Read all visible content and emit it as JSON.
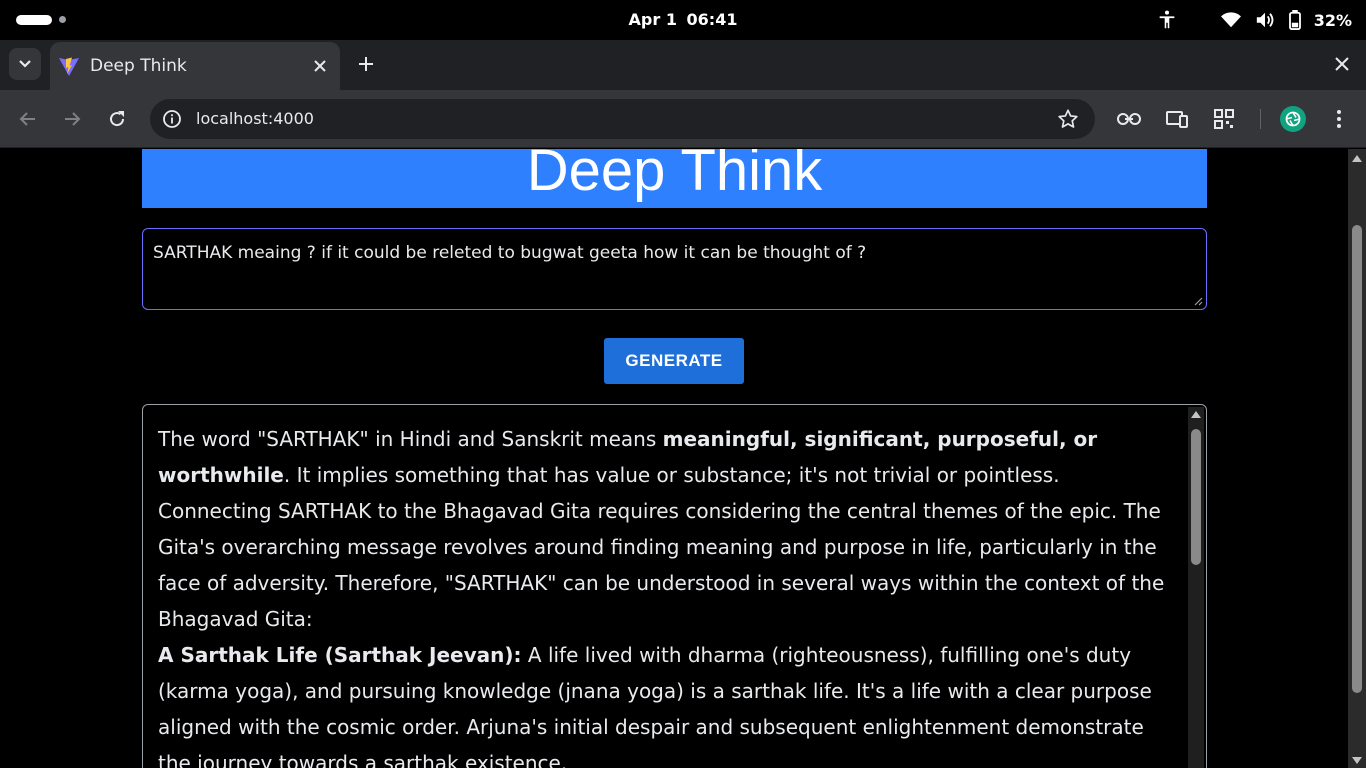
{
  "system": {
    "date": "Apr 1",
    "time": "06:41",
    "battery": "32%"
  },
  "browser": {
    "tab_title": "Deep Think",
    "url": "localhost:4000"
  },
  "page": {
    "title": "Deep Think",
    "prompt": "SARTHAK meaing ? if it could be releted to bugwat geeta how it can be thought of ?",
    "generate_label": "GENERATE",
    "output": {
      "p1_a": "The word \"SARTHAK\" in Hindi and Sanskrit means ",
      "p1_b": "meaningful, significant, purposeful, or worthwhile",
      "p1_c": ". It implies something that has value or substance; it's not trivial or pointless.",
      "p2": "Connecting SARTHAK to the Bhagavad Gita requires considering the central themes of the epic. The Gita's overarching message revolves around finding meaning and purpose in life, particularly in the face of adversity. Therefore, \"SARTHAK\" can be understood in several ways within the context of the Bhagavad Gita:",
      "p3_a": "A Sarthak Life (Sarthak Jeevan):",
      "p3_b": " A life lived with dharma (righteousness), fulfilling one's duty (karma yoga), and pursuing knowledge (jnana yoga) is a sarthak life. It's a life with a clear purpose aligned with the cosmic order. Arjuna's initial despair and subsequent enlightenment demonstrate the journey towards a sarthak existence."
    }
  },
  "colors": {
    "banner": "#2f80ff",
    "button": "#1e6fd9",
    "prompt_border": "#6b6cff"
  }
}
